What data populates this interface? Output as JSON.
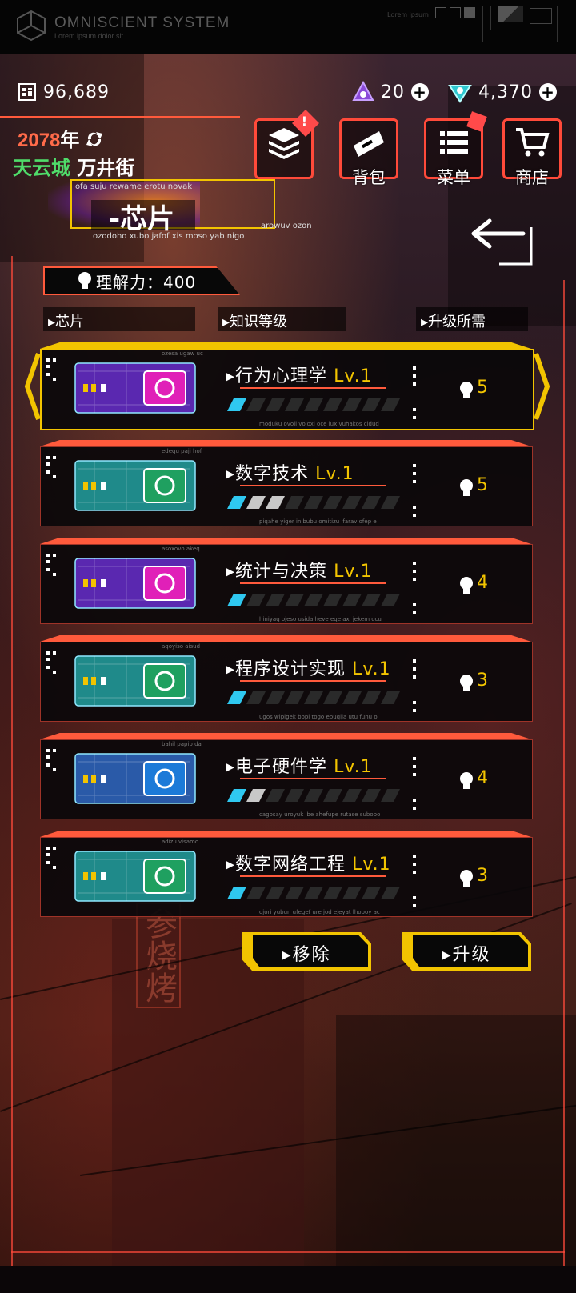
{
  "system": {
    "title": "OMNISCIENT SYSTEM",
    "subtitle": "Lorem ipsum dolor sit",
    "right_label": "Lorem ipsum"
  },
  "currency": {
    "coins": "96,689",
    "gems_purple": "20",
    "gems_cyan": "4,370",
    "add_symbol": "+"
  },
  "status": {
    "year": "2078",
    "year_suffix": "年",
    "city": "天云城",
    "street": "万井街"
  },
  "nav": [
    {
      "label": "",
      "icon": "layers-icon",
      "badge": "!"
    },
    {
      "label": "背包",
      "icon": "backpack-icon"
    },
    {
      "label": "菜单",
      "icon": "menu-list-icon"
    },
    {
      "label": "商店",
      "icon": "shopping-cart-icon"
    }
  ],
  "page": {
    "title": "-芯片",
    "tag_top": "ofa suju rewame erotu novak",
    "tag_right": "arowuv ozon",
    "tag_bottom": "ozodoho xubo jafof xis moso yab nigo"
  },
  "comprehension": {
    "label": "理解力：",
    "value": "400"
  },
  "headers": {
    "chip": "芯片",
    "level": "知识等级",
    "cost": "升级所需"
  },
  "chips": [
    {
      "name": "行为心理学",
      "level": "Lv.1",
      "cost": "5",
      "progress_segments": 1,
      "gray_segments": 0,
      "tag": "ozesa ugaw uc",
      "micro": "moduku ovoli voloxi oce lux vuhakos cidud",
      "accent": "#e020b8",
      "body": "#5a28b0",
      "selected": true
    },
    {
      "name": "数字技术",
      "level": "Lv.1",
      "cost": "5",
      "progress_segments": 1,
      "gray_segments": 2,
      "tag": "edequ paji hof",
      "micro": "piqahe yiger inibubu omitizu ifarav ofep e",
      "accent": "#1fa060",
      "body": "#1f8a8a",
      "selected": false
    },
    {
      "name": "统计与决策",
      "level": "Lv.1",
      "cost": "4",
      "progress_segments": 1,
      "gray_segments": 0,
      "tag": "asoxovo akeq",
      "micro": "hiniyaq ojeso usida heve eqe axi jekem ocu",
      "accent": "#e020b8",
      "body": "#5a28b0",
      "selected": false
    },
    {
      "name": "程序设计实现",
      "level": "Lv.1",
      "cost": "3",
      "progress_segments": 1,
      "gray_segments": 0,
      "tag": "aqoyiso aisud",
      "micro": "ugos wipigek bopl togo epuqija utu funu o",
      "accent": "#1fa060",
      "body": "#1f8a8a",
      "selected": false
    },
    {
      "name": "电子硬件学",
      "level": "Lv.1",
      "cost": "4",
      "progress_segments": 1,
      "gray_segments": 1,
      "tag": "bahil papib da",
      "micro": "cagosay uroyuk ibe ahefupe rutase subopo",
      "accent": "#1c7ad8",
      "body": "#2a5aa8",
      "selected": false
    },
    {
      "name": "数字网络工程",
      "level": "Lv.1",
      "cost": "3",
      "progress_segments": 1,
      "gray_segments": 0,
      "tag": "adizu visamo",
      "micro": "ojori yubun ufegef ure jod ejeyat lhoboy ac",
      "accent": "#1fa060",
      "body": "#1f8a8a",
      "selected": false
    }
  ],
  "actions": {
    "remove": "移除",
    "upgrade": "升级"
  },
  "colors": {
    "accent_orange": "#ff5a3c",
    "accent_yellow": "#f2c400",
    "progress_cyan": "#2fc8f0"
  }
}
